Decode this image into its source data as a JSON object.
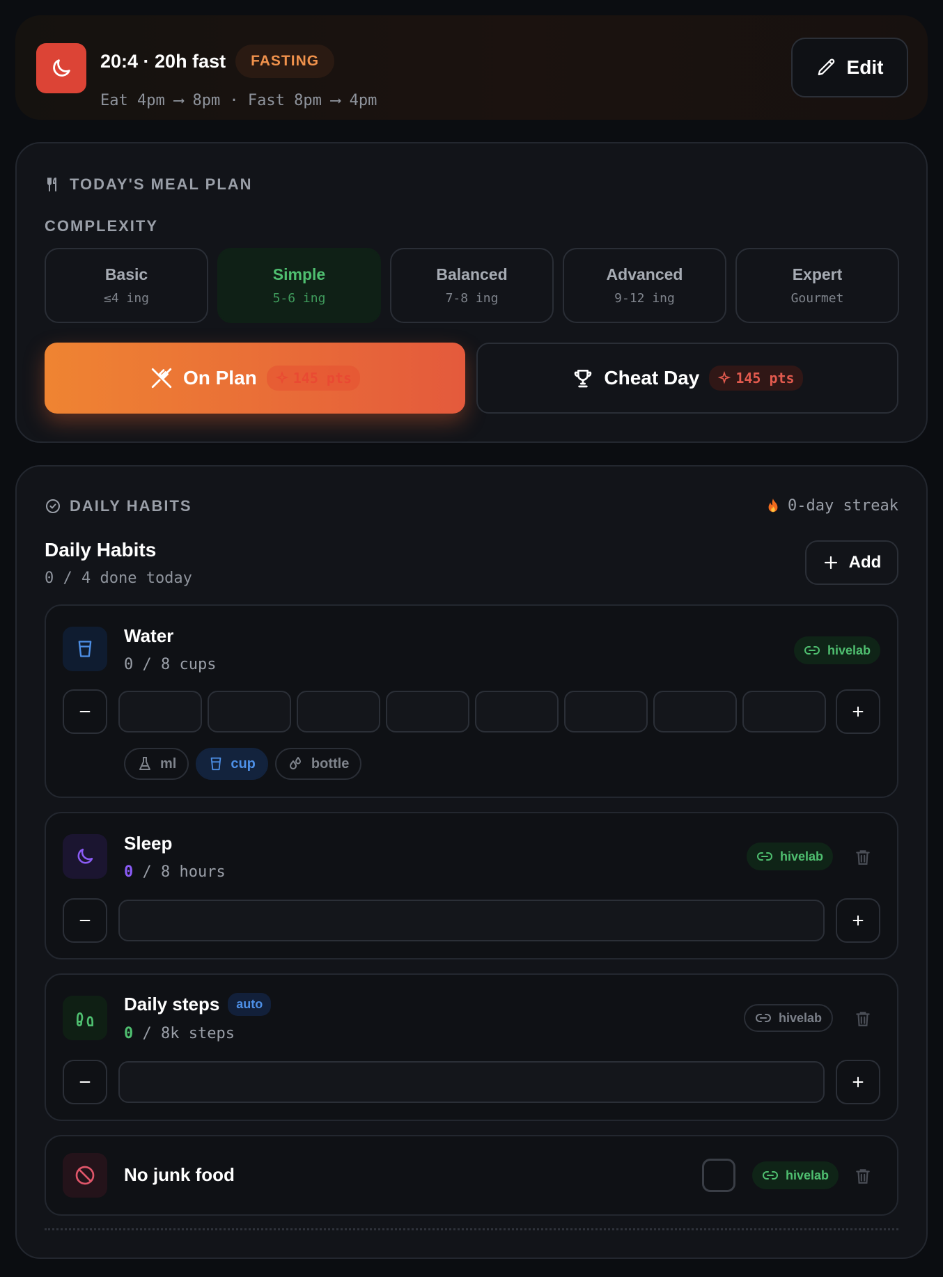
{
  "fasting": {
    "title": "20:4 · 20h fast",
    "status": "FASTING",
    "schedule": "Eat 4pm ⟶ 8pm · Fast 8pm ⟶ 4pm",
    "edit_label": "Edit",
    "icon": "moon-icon",
    "accent": "#dc4436"
  },
  "meal_plan": {
    "section_label": "TODAY'S MEAL PLAN",
    "complexity_label": "COMPLEXITY",
    "options": [
      {
        "name": "Basic",
        "detail": "≤4 ing"
      },
      {
        "name": "Simple",
        "detail": "5-6 ing"
      },
      {
        "name": "Balanced",
        "detail": "7-8 ing"
      },
      {
        "name": "Advanced",
        "detail": "9-12 ing"
      },
      {
        "name": "Expert",
        "detail": "Gourmet"
      }
    ],
    "selected": "Simple",
    "on_plan": {
      "label": "On Plan",
      "pts": "145 pts"
    },
    "cheat_day": {
      "label": "Cheat Day",
      "pts": "145 pts"
    }
  },
  "habits": {
    "section_label": "DAILY HABITS",
    "streak": "0-day streak",
    "title": "Daily Habits",
    "summary": "0 / 4 done today",
    "add_label": "Add",
    "items": [
      {
        "name": "Water",
        "progress": "0 / 8 cups",
        "link": "hivelab",
        "units": [
          "ml",
          "cup",
          "bottle"
        ],
        "selected_unit": "cup",
        "cups_filled": 0,
        "cups_total": 8
      },
      {
        "name": "Sleep",
        "progress_value": "0",
        "progress_rest": " / 8 hours",
        "link": "hivelab",
        "fill_fraction": 0
      },
      {
        "name": "Daily steps",
        "badge": "auto",
        "progress_value": "0",
        "progress_rest": " / 8k steps",
        "link": "hivelab",
        "fill_fraction": 0
      },
      {
        "name": "No junk food",
        "link": "hivelab",
        "checked": false
      }
    ]
  },
  "colors": {
    "accent_orange": "#ef8432",
    "green": "#4fbf70",
    "blue": "#4d8fe6",
    "purple": "#8b5cf6"
  }
}
